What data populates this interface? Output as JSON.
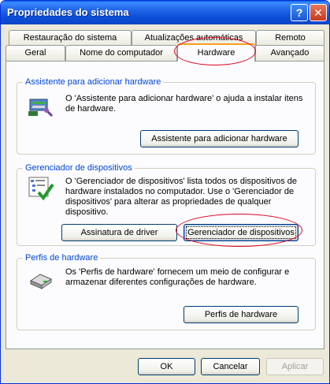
{
  "window": {
    "title": "Propriedades do sistema"
  },
  "tabs_row1": [
    "Restauração do sistema",
    "Atualizações automáticas",
    "Remoto"
  ],
  "tabs_row2": [
    "Geral",
    "Nome do computador",
    "Hardware",
    "Avançado"
  ],
  "active_tab": "Hardware",
  "add_hardware": {
    "title": "Assistente para adicionar hardware",
    "description": "O 'Assistente para adicionar hardware' o ajuda a instalar itens de hardware.",
    "button": "Assistente para adicionar hardware",
    "icon": "add-hardware-wizard-icon"
  },
  "device_manager": {
    "title": "Gerenciador de dispositivos",
    "description": "O 'Gerenciador de dispositivos' lista todos os dispositivos de hardware instalados no computador. Use o 'Gerenciador de dispositivos' para alterar as propriedades de qualquer dispositivo.",
    "button_driver": "Assinatura de driver",
    "button_manager": "Gerenciador de dispositivos",
    "icon": "device-manager-icon"
  },
  "hardware_profiles": {
    "title": "Perfis de hardware",
    "description": "Os 'Perfis de hardware' fornecem um meio de configurar e armazenar diferentes configurações de hardware.",
    "button": "Perfis de hardware",
    "icon": "hardware-profiles-icon"
  },
  "footer": {
    "ok": "OK",
    "cancel": "Cancelar",
    "apply": "Aplicar"
  },
  "colors": {
    "title_bar": "#0b4fd8",
    "group_title": "#0046d5",
    "annotation": "#e0001b",
    "active_tab_accent": "#ff9f1f"
  }
}
